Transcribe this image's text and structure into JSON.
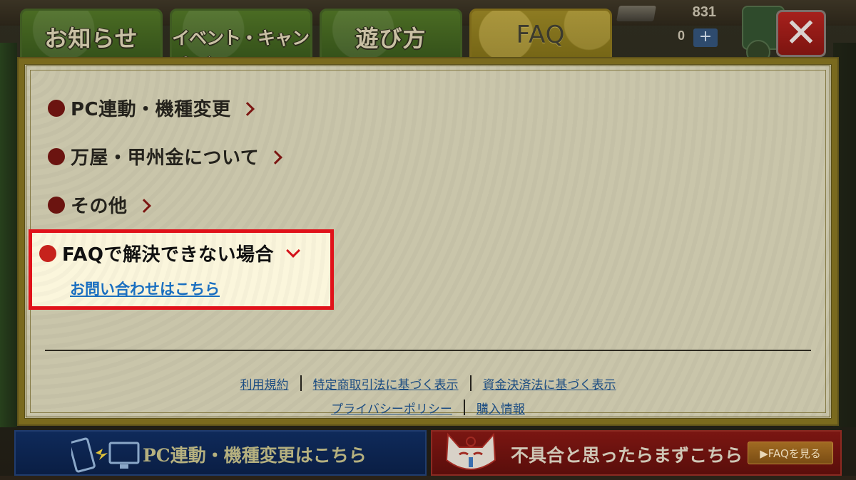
{
  "tabs": [
    {
      "label": "お知らせ",
      "active": false
    },
    {
      "label": "イベント・キャンペーン",
      "active": false
    },
    {
      "label": "遊び方",
      "active": false
    },
    {
      "label": "FAQ",
      "active": true
    }
  ],
  "currency": {
    "amount_top": "831",
    "amount_bottom": "0",
    "plus_label": "+"
  },
  "close_label": "✕",
  "faq": {
    "items": [
      {
        "label": "PC連動・機種変更"
      },
      {
        "label": "万屋・甲州金について"
      },
      {
        "label": "その他"
      }
    ],
    "expanded": {
      "label": "FAQで解決できない場合",
      "link": "お問い合わせはこちら"
    }
  },
  "footer": {
    "row1": [
      "利用規約",
      "特定商取引法に基づく表示",
      "資金決済法に基づく表示"
    ],
    "row2": [
      "プライバシーポリシー",
      "購入情報"
    ]
  },
  "banners": {
    "left": {
      "text": "PC連動・機種変更はこちら"
    },
    "right": {
      "text": "不具合と思ったらまずこちら",
      "button": "▶FAQを見る"
    }
  },
  "colors": {
    "highlight": "#e0121a",
    "link": "#1a6fc0",
    "bullet": "#c6221c"
  }
}
